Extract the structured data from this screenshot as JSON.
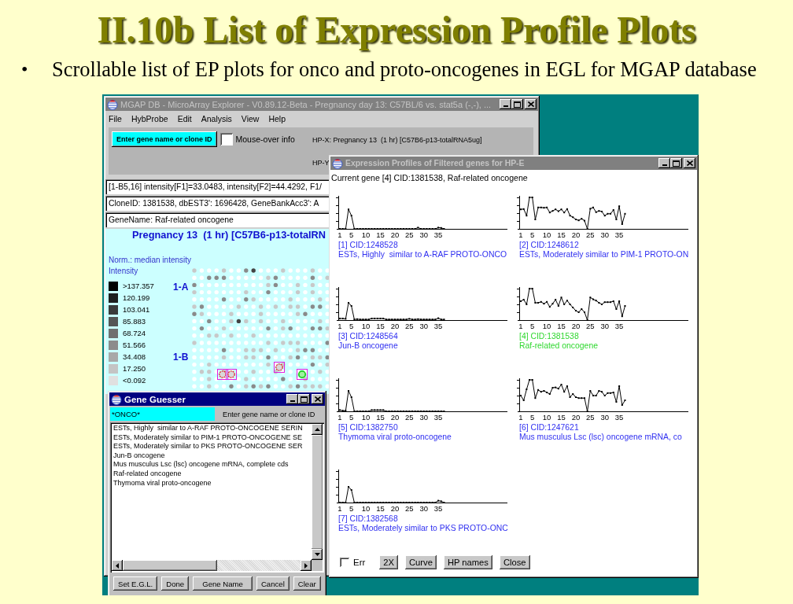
{
  "slide": {
    "title": "II.10b List of Expression Profile Plots",
    "bullets": [
      {
        "marker": "•",
        "text": "Scrollable list of EP plots for onco and proto-oncogenes in EGL for MGAP database"
      }
    ]
  },
  "main_window": {
    "title": "MGAP DB - MicroArray Explorer - V0.89.12-Beta - Pregnancy day 13: C57BL/6 vs. stat5a (-,-), ...",
    "active": false,
    "menu": [
      "File",
      "HybProbe",
      "Edit",
      "Analysis",
      "View",
      "Help"
    ],
    "lookup_button": "Enter gene name or clone ID",
    "mouse_over": {
      "label": "Mouse-over info",
      "checked": false
    },
    "hp_x": "HP-X: Pregnancy 13  (1 hr) [C57B6-p13-totalRNA5ug]",
    "hp_y": "HP-Y",
    "info_fields": [
      "[1-B5,16] intensity[F1]=33.0483, intensity[F2]=44.4292, F1/",
      "CloneID: 1381538, dbEST3': 1696428, GeneBankAcc3': A",
      "GeneName: Raf-related oncogene"
    ],
    "array_view": {
      "title": "Pregnancy 13  (1 hr) [C57B6-p13-totalRN",
      "norm_label": "Norm.: median intensity",
      "legend_title": "Intensity",
      "legend": [
        {
          "label": ">137.357",
          "color": "#000000"
        },
        {
          "label": "120.199",
          "color": "#1e1e1e"
        },
        {
          "label": "103.041",
          "color": "#3a3a3a"
        },
        {
          "label": "85.883",
          "color": "#555555"
        },
        {
          "label": "68.724",
          "color": "#707070"
        },
        {
          "label": "51.566",
          "color": "#8c8c8c"
        },
        {
          "label": "34.408",
          "color": "#a8a8a8"
        },
        {
          "label": "17.250",
          "color": "#c4c4c4"
        },
        {
          "label": "<0.092",
          "color": "#e0e0e0"
        }
      ],
      "blocks": [
        {
          "label": "1-A"
        },
        {
          "label": "1-B"
        }
      ],
      "spot_markers": [
        {
          "selected": false
        },
        {
          "selected": false
        },
        {
          "selected": false
        },
        {
          "selected": true
        }
      ]
    }
  },
  "gene_guesser": {
    "title": "Gene Guesser",
    "active": true,
    "query": "*ONCO*",
    "hint": "Enter gene name or clone ID",
    "results": [
      "ESTs, Highly  similar to A-RAF PROTO-ONCOGENE SERIN",
      "ESTs, Moderately similar to PIM-1 PROTO-ONCOGENE SE",
      "ESTs, Moderately similar to PKS PROTO-ONCOGENE SER",
      "Jun-B oncogene",
      "Mus musculus Lsc (lsc) oncogene mRNA, complete cds",
      "Raf-related oncogene",
      "Thymoma viral proto-oncogene"
    ],
    "buttons": [
      "Set E.G.L.",
      "Done",
      "Gene Name",
      "Cancel",
      "Clear"
    ]
  },
  "expression_window": {
    "title": "Expression Profiles of Filtered genes for HP-E",
    "active": false,
    "current_gene": "Current gene [4] CID:1381538, Raf-related oncogene",
    "plots": [
      {
        "id": "[1] CID:1248528",
        "name": "ESTs, Highly  similar to A-RAF PROTO-ONCO",
        "selected": false,
        "x_labels": [
          "1",
          "5",
          "10",
          "15",
          "20",
          "25",
          "30",
          "35"
        ]
      },
      {
        "id": "[2] CID:1248612",
        "name": "ESTs, Moderately similar to PIM-1 PROTO-ON",
        "selected": false,
        "x_labels": [
          "1",
          "5",
          "10",
          "15",
          "20",
          "25",
          "30",
          "35"
        ]
      },
      {
        "id": "[3] CID:1248564",
        "name": "Jun-B oncogene",
        "selected": false,
        "x_labels": [
          "1",
          "5",
          "10",
          "15",
          "20",
          "25",
          "30",
          "35"
        ]
      },
      {
        "id": "[4] CID:1381538",
        "name": "Raf-related oncogene",
        "selected": true,
        "x_labels": [
          "1",
          "5",
          "10",
          "15",
          "20",
          "25",
          "30",
          "35"
        ]
      },
      {
        "id": "[5] CID:1382750",
        "name": "Thymoma viral proto-oncogene",
        "selected": false,
        "x_labels": [
          "1",
          "5",
          "10",
          "15",
          "20",
          "25",
          "30",
          "35"
        ]
      },
      {
        "id": "[6] CID:1247621",
        "name": "Mus musculus Lsc (lsc) oncogene mRNA, co",
        "selected": false,
        "x_labels": [
          "1",
          "5",
          "10",
          "15",
          "20",
          "25",
          "30",
          "35"
        ]
      },
      {
        "id": "[7] CID:1382568",
        "name": "ESTs, Moderately similar to PKS PROTO-ONC",
        "selected": false,
        "x_labels": [
          "1",
          "5",
          "10",
          "15",
          "20",
          "25",
          "30",
          "35"
        ]
      }
    ],
    "err": {
      "label": "Err",
      "checked": false
    },
    "buttons": [
      "2X",
      "Curve",
      "HP names",
      "Close"
    ]
  }
}
